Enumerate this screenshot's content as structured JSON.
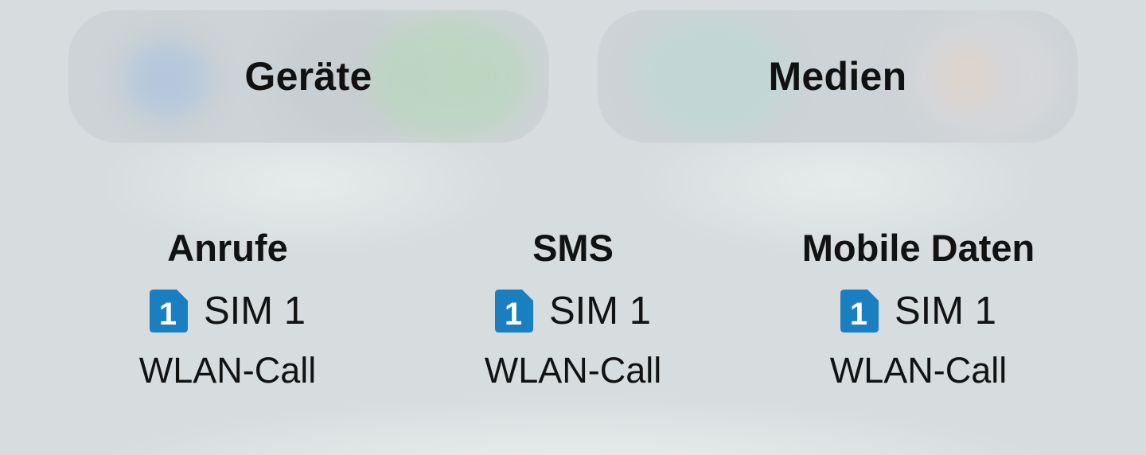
{
  "tiles": {
    "devices_label": "Geräte",
    "media_label": "Medien"
  },
  "sim_settings": [
    {
      "title": "Anrufe",
      "sim_badge": "1",
      "sim_label": "SIM 1",
      "status": "WLAN-Call"
    },
    {
      "title": "SMS",
      "sim_badge": "1",
      "sim_label": "SIM 1",
      "status": "WLAN-Call"
    },
    {
      "title": "Mobile Daten",
      "sim_badge": "1",
      "sim_label": "SIM 1",
      "status": "WLAN-Call"
    }
  ],
  "colors": {
    "sim_badge": "#1a7fc1",
    "text": "#121212",
    "background": "#d7dddf"
  },
  "icons": {
    "sim": "sim-card-icon"
  }
}
